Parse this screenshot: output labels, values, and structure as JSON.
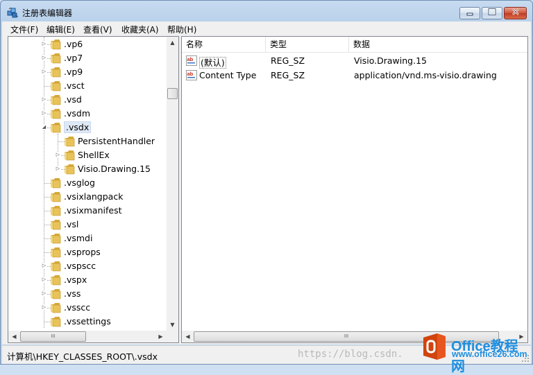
{
  "window": {
    "title": "注册表编辑器",
    "buttons": {
      "minimize": "━",
      "maximize": "□",
      "close": "✕"
    }
  },
  "menu": [
    {
      "label": "文件(F)"
    },
    {
      "label": "编辑(E)"
    },
    {
      "label": "查看(V)"
    },
    {
      "label": "收藏夹(A)"
    },
    {
      "label": "帮助(H)"
    }
  ],
  "tree": {
    "items": [
      {
        "label": ".vp6",
        "expander": "▷"
      },
      {
        "label": ".vp7",
        "expander": "▷"
      },
      {
        "label": ".vp9",
        "expander": "▷"
      },
      {
        "label": ".vsct",
        "expander": ""
      },
      {
        "label": ".vsd",
        "expander": "▷"
      },
      {
        "label": ".vsdm",
        "expander": "▷"
      },
      {
        "label": ".vsdx",
        "expander": "◢"
      },
      {
        "label": "PersistentHandler",
        "expander": ""
      },
      {
        "label": "ShellEx",
        "expander": "▷"
      },
      {
        "label": "Visio.Drawing.15",
        "expander": "▷"
      },
      {
        "label": ".vsglog",
        "expander": ""
      },
      {
        "label": ".vsixlangpack",
        "expander": ""
      },
      {
        "label": ".vsixmanifest",
        "expander": ""
      },
      {
        "label": ".vsl",
        "expander": ""
      },
      {
        "label": ".vsmdi",
        "expander": ""
      },
      {
        "label": ".vsprops",
        "expander": ""
      },
      {
        "label": ".vspscc",
        "expander": "▷"
      },
      {
        "label": ".vspx",
        "expander": "▷"
      },
      {
        "label": ".vss",
        "expander": "▷"
      },
      {
        "label": ".vsscc",
        "expander": "▷"
      },
      {
        "label": ".vssettings",
        "expander": ""
      }
    ],
    "selected": ".vsdx",
    "scroll": {
      "up": "▲",
      "down": "▼",
      "left": "◀",
      "right": "▶",
      "grip": "III"
    }
  },
  "list": {
    "columns": [
      "名称",
      "类型",
      "数据"
    ],
    "rows": [
      {
        "name": "(默认)",
        "type": "REG_SZ",
        "data": "Visio.Drawing.15",
        "icon": "string-value-icon"
      },
      {
        "name": "Content Type",
        "type": "REG_SZ",
        "data": "application/vnd.ms-visio.drawing",
        "icon": "string-value-icon"
      }
    ],
    "scroll": {
      "left": "◀",
      "right": "▶",
      "grip": "III"
    }
  },
  "status": {
    "path": "计算机\\HKEY_CLASSES_ROOT\\.vsdx",
    "watermark_url": "https://blog.csdn.",
    "watermark_brand": "Office教程网",
    "watermark_site": "www.office26.com"
  },
  "colors": {
    "titlebar": "#c7dbf0",
    "folder": "#e8c35a",
    "selection": "#dfe9f5",
    "close_button": "#c03a23",
    "watermark": "#1f8fe0"
  }
}
